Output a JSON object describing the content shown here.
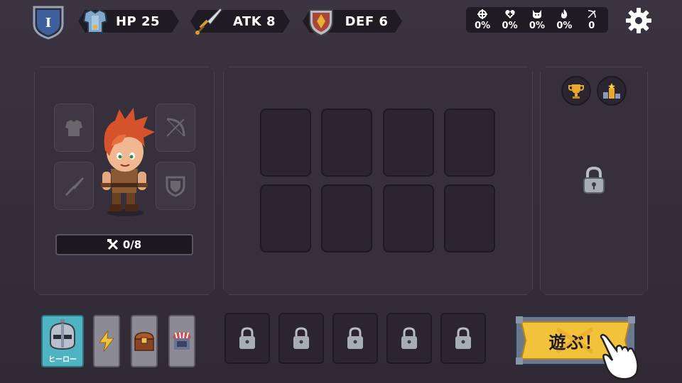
{
  "level": {
    "label": "I"
  },
  "stats": {
    "hp": "HP 25",
    "atk": "ATK 8",
    "def": "DEF 6"
  },
  "mini_stats": [
    {
      "icon": "crosshair-icon",
      "value": "0%"
    },
    {
      "icon": "heart-plus-icon",
      "value": "0%"
    },
    {
      "icon": "cat-icon",
      "value": "0%"
    },
    {
      "icon": "flame-icon",
      "value": "0%"
    },
    {
      "icon": "bow-arrow-icon",
      "value": "0"
    }
  ],
  "crafting": {
    "progress": "0/8"
  },
  "tabs": {
    "hero_label": "ヒーロー"
  },
  "play": {
    "label": "遊ぶ！"
  },
  "colors": {
    "background": "#342f3a",
    "hero_tab": "#4fb3c2",
    "play_button": "#f2c23a",
    "accent_gold": "#e8a82c"
  }
}
